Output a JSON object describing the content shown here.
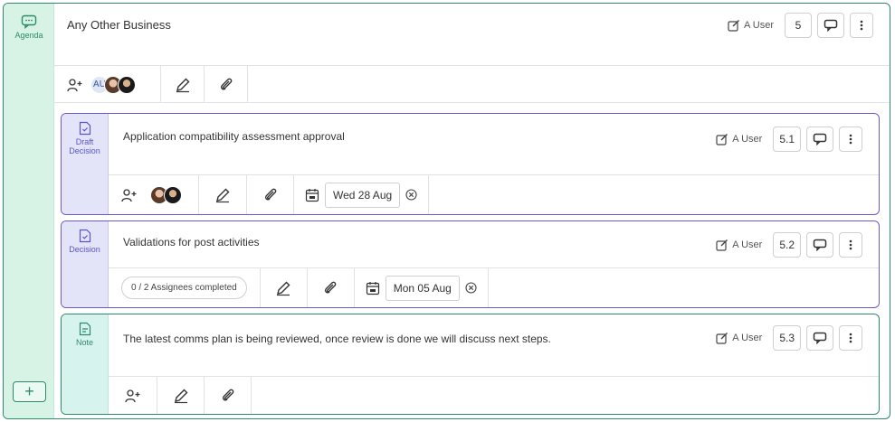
{
  "sidebar": {
    "agenda_label": "Agenda"
  },
  "main_item": {
    "title": "Any Other Business",
    "user": "A User",
    "number": "5",
    "avatar_initials": "AU"
  },
  "items": [
    {
      "type_label_1": "Draft",
      "type_label_2": "Decision",
      "title": "Application compatibility assessment approval",
      "user": "A User",
      "number": "5.1",
      "date": "Wed 28 Aug"
    },
    {
      "type_label": "Decision",
      "title": "Validations for post activities",
      "user": "A User",
      "number": "5.2",
      "assignees": "0 / 2 Assignees completed",
      "date": "Mon 05 Aug"
    },
    {
      "type_label": "Note",
      "title": "The latest comms plan is being reviewed, once review is done we will discuss next steps.",
      "user": "A User",
      "number": "5.3"
    }
  ],
  "colors": {
    "green": "#2e8b6a",
    "purple": "#6a5acd"
  }
}
